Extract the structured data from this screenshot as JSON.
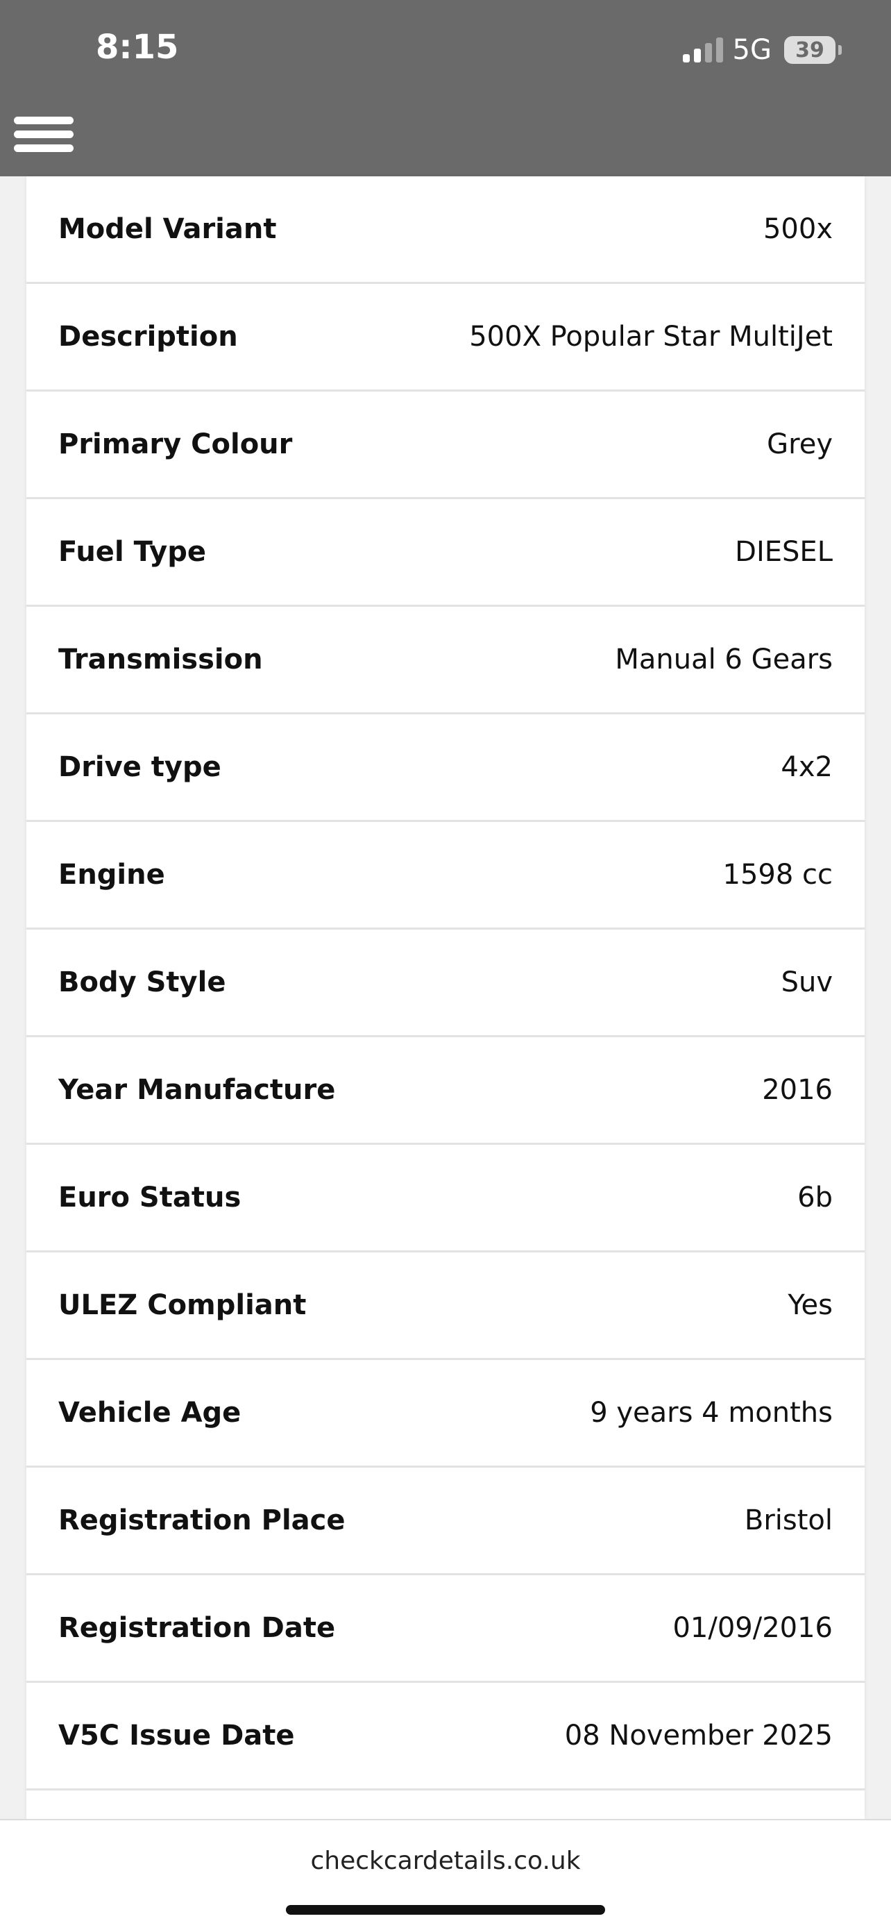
{
  "status_bar": {
    "time": "8:15",
    "network": "5G",
    "battery": "39"
  },
  "rows": [
    {
      "label": "Model Variant",
      "value": "500x"
    },
    {
      "label": "Description",
      "value": "500X Popular Star MultiJet"
    },
    {
      "label": "Primary Colour",
      "value": "Grey"
    },
    {
      "label": "Fuel Type",
      "value": "DIESEL"
    },
    {
      "label": "Transmission",
      "value": "Manual 6 Gears"
    },
    {
      "label": "Drive type",
      "value": "4x2"
    },
    {
      "label": "Engine",
      "value": "1598 cc"
    },
    {
      "label": "Body Style",
      "value": "Suv"
    },
    {
      "label": "Year Manufacture",
      "value": "2016"
    },
    {
      "label": "Euro Status",
      "value": "6b"
    },
    {
      "label": "ULEZ Compliant",
      "value": "Yes"
    },
    {
      "label": "Vehicle Age",
      "value": "9 years 4 months"
    },
    {
      "label": "Registration Place",
      "value": "Bristol"
    },
    {
      "label": "Registration Date",
      "value": "01/09/2016"
    },
    {
      "label": "V5C Issue Date",
      "value": "08 November 2025"
    }
  ],
  "browser": {
    "url": "checkcardetails.co.uk"
  },
  "colors": {
    "header_bg": "#6a6a6a",
    "page_bg": "#f1f1f1",
    "card_bg": "#ffffff",
    "divider": "#e2e2e2"
  }
}
